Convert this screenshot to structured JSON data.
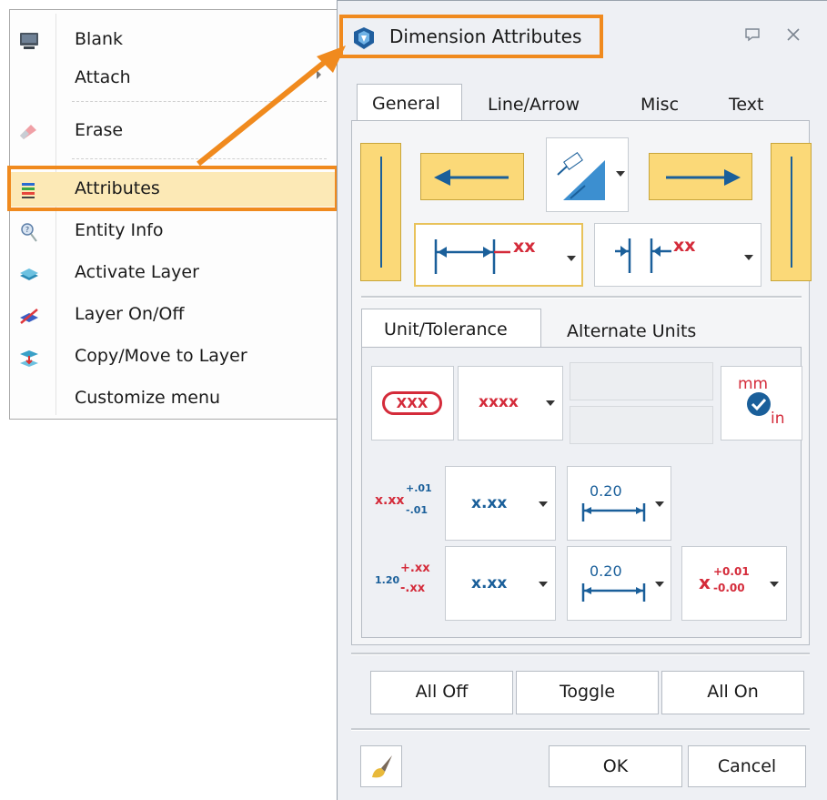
{
  "context_menu": {
    "items": [
      {
        "label": "Blank",
        "icon": "monitor-icon"
      },
      {
        "label": "Attach",
        "icon": ""
      },
      {
        "label": "Erase",
        "icon": "eraser-icon"
      },
      {
        "label": "Attributes",
        "icon": "attributes-icon",
        "highlighted": true
      },
      {
        "label": "Entity Info",
        "icon": "entity-info-icon"
      },
      {
        "label": "Activate Layer",
        "icon": "layer-icon"
      },
      {
        "label": "Layer On/Off",
        "icon": "layer-toggle-icon"
      },
      {
        "label": "Copy/Move to Layer",
        "icon": "copy-move-layer-icon"
      },
      {
        "label": "Customize menu",
        "icon": ""
      }
    ]
  },
  "dialog": {
    "title": "Dimension Attributes",
    "tabs": [
      "General",
      "Line/Arrow",
      "Misc",
      "Text"
    ],
    "active_tab": "General",
    "general": {
      "text_position_label": "xx",
      "text_position2_label": "xx"
    },
    "sub_tabs": [
      "Unit/Tolerance",
      "Alternate Units"
    ],
    "active_sub_tab": "Unit/Tolerance",
    "unit_tolerance": {
      "basic_label": "XXX",
      "precision_format": "xxxx",
      "unit_icon": {
        "top": "mm",
        "bottom": "in"
      },
      "tol_icon1": {
        "base": "x.xx",
        "plus": "+.01",
        "minus": "-.01"
      },
      "tol_icon2": {
        "base": "1.20",
        "plus": "+.xx",
        "minus": "-.xx"
      },
      "tol_precision1": "x.xx",
      "tol_precision2": "x.xx",
      "dim_value1": "0.20",
      "dim_value2": "0.20",
      "tol_format": {
        "base": "x",
        "plus": "+0.01",
        "minus": "-0.00"
      }
    },
    "buttons": {
      "all_off": "All Off",
      "toggle": "Toggle",
      "all_on": "All On",
      "ok": "OK",
      "cancel": "Cancel"
    }
  },
  "colors": {
    "highlight_orange": "#f08a1e",
    "highlight_fill": "#fce9b6",
    "yellow_button": "#fbd978",
    "dim_blue": "#1a5f9a",
    "dim_red": "#d42b3a"
  }
}
